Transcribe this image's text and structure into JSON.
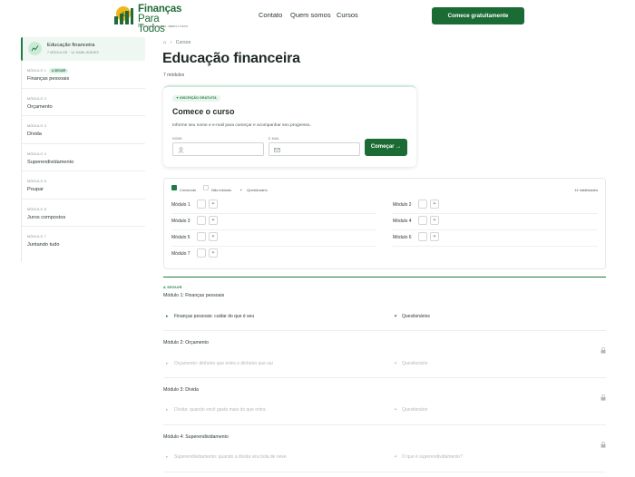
{
  "header": {
    "logo": {
      "line1": "Finanças",
      "line2": "Para Todos",
      "tagline": "EDUCAÇÃO FINANCEIRA · ABERTA A TODOS"
    },
    "nav": [
      "Contato",
      "Quem somos",
      "Cursos"
    ],
    "cta": "Comece gratuitamente"
  },
  "sidebar": {
    "course_title": "Educação financeira",
    "course_sub": "7 MÓDULOS · 14 HABILIDADES",
    "next_badge": "A SEGUIR",
    "modules": [
      {
        "num": "MÓDULO 1",
        "name": "Finanças pessoais"
      },
      {
        "num": "MÓDULO 2",
        "name": "Orçamento"
      },
      {
        "num": "MÓDULO 3",
        "name": "Dívida"
      },
      {
        "num": "MÓDULO 4",
        "name": "Superendividamento"
      },
      {
        "num": "MÓDULO 5",
        "name": "Poupar"
      },
      {
        "num": "MÓDULO 6",
        "name": "Juros compostos"
      },
      {
        "num": "MÓDULO 7",
        "name": "Juntando tudo"
      }
    ]
  },
  "main": {
    "breadcrumb": "Cursos",
    "title": "Educação financeira",
    "module_count": "7 módulos",
    "signup": {
      "badge": "✦ INSCRIÇÃO GRATUITA",
      "title": "Comece o curso",
      "description": "Informe seu nome e e-mail para começar e acompanhar seu progresso.",
      "name_label": "NOME",
      "email_label": "E-MAIL",
      "button": "Começar →"
    },
    "legend": {
      "completed": "Concluído",
      "not_started": "Não iniciado",
      "quizzes": "Questionário",
      "skills_count": "14 habilidades"
    },
    "modules_grid": [
      "Módulo 1",
      "Módulo 2",
      "Módulo 3",
      "Módulo 4",
      "Módulo 5",
      "Módulo 6",
      "Módulo 7"
    ],
    "next_label": "A SEGUIR",
    "sections": [
      {
        "title": "Módulo 1: Finanças pessoais",
        "lesson": "Finanças pessoais: cuidar do que é seu",
        "quiz": "Questionários"
      },
      {
        "title": "Módulo 2: Orçamento",
        "lesson": "Orçamento: dinheiro que entra e dinheiro que sai",
        "quiz": "Questionário"
      },
      {
        "title": "Módulo 3: Dívida",
        "lesson": "Dívida: quando você gasta mais do que entra",
        "quiz": "Questionário"
      },
      {
        "title": "Módulo 4: Superendividamento",
        "lesson": "Superendividamento: quando a dívida vira bola de neve",
        "quiz": "O que é superendividamento?"
      }
    ]
  },
  "colors": {
    "brand": "#1b6b35",
    "accent": "#1f7a43",
    "light": "#e7f5ec"
  }
}
